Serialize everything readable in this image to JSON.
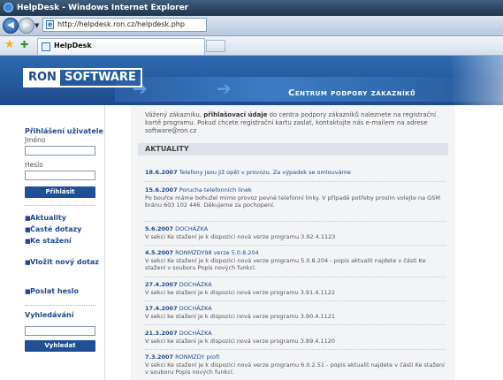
{
  "window": {
    "title": "HelpDesk - Windows Internet Explorer"
  },
  "browser": {
    "url": "http://helpdesk.ron.cz/helpdesk.php",
    "tab_label": "HelpDesk"
  },
  "brand": {
    "logo_left": "RON",
    "logo_right": "SOFTWARE",
    "center_title": "Centrum podpory zákazníků"
  },
  "sidebar": {
    "login_heading": "Přihlášení uživatele",
    "name_label": "Jméno",
    "password_label": "Heslo",
    "login_button": "Přihlásit",
    "nav": [
      "Aktuality",
      "Časté dotazy",
      "Ke stažení"
    ],
    "new_query": "Vložit nový dotaz",
    "send_password": "Poslat heslo",
    "search_heading": "Vyhledávání",
    "search_button": "Vyhledat"
  },
  "intro": {
    "part1": "Vážený zákazníku, ",
    "bold": "přihlašovací údaje",
    "part2": " do centra podpory zákazníků naleznete na registrační kartě programu. Pokud chcete registrační kartu zaslat, kontaktujte nás e-mailem na adrese software@ron.cz"
  },
  "news_heading": "AKTUALITY",
  "news": [
    {
      "date": "18.6.2007",
      "title": "Telefony jsou již opět v provozu. Za výpadek se omlouváme",
      "body": ""
    },
    {
      "date": "15.6.2007",
      "title": "Porucha telefonních linek",
      "body": "Po bouřce máme bohužel mimo provoz pevné telefonní linky. V případě potřeby prosím volejte na GSM bránu 603 102 446. Děkujeme za pochopení."
    },
    {
      "date": "5.6.2007",
      "title": "DOCHÁZKA",
      "body": "V sekci Ke stažení je k dispozici nová verze programu 3.92.4.1123"
    },
    {
      "date": "4.5.2007",
      "title": "RONMZDY98 verze 5.0.8.204",
      "body": "V sekci Ke stažení je k dispozici nová verze programu 5.0.8.204 - popis aktualit najdete v části Ke stažení v souboru Popis nových funkcí."
    },
    {
      "date": "27.4.2007",
      "title": "DOCHÁZKA",
      "body": "V sekci ke stažení je k dispozici nová verze programu 3.91.4.1122"
    },
    {
      "date": "17.4.2007",
      "title": "DOCHÁZKA",
      "body": "V sekci ke stažení je k dispozici nová verze programu 3.90.4.1121"
    },
    {
      "date": "21.3.2007",
      "title": "DOCHÁZKA",
      "body": "V sekci ke stažení je k dispozici nová verze programu 3.89.4.1120"
    },
    {
      "date": "7.3.2007",
      "title": "RONMZDY profi",
      "body": "V sekci Ke stažení je k dispozici nová verze programu 6.0.2.51 - popis aktualit najdete v části Ke stažení v souboru Popis nových funkcí."
    }
  ]
}
